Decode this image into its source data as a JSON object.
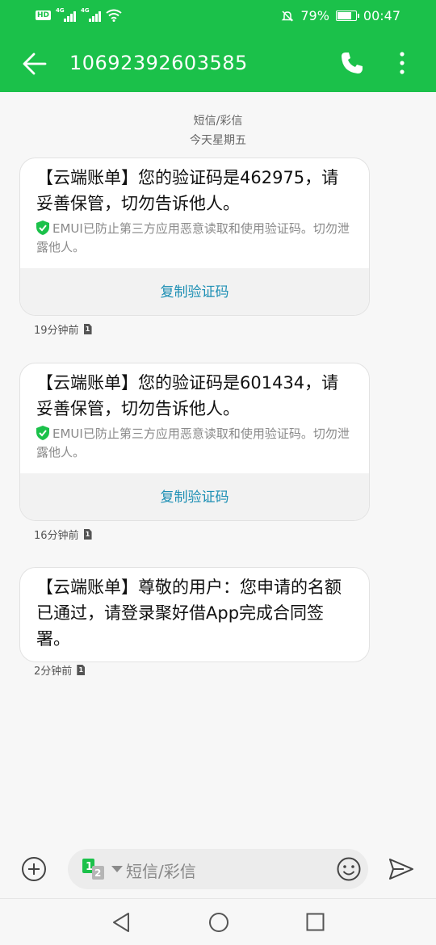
{
  "status": {
    "hd": "HD",
    "net1": "4G",
    "net2": "4G",
    "battery": "79%",
    "battery_level": 0.79,
    "time": "00:47"
  },
  "appbar": {
    "title": "10692392603585"
  },
  "thread": {
    "type_label": "短信/彩信",
    "date_label": "今天星期五"
  },
  "messages": [
    {
      "text": "【云端账单】您的验证码是462975，请妥善保管，切勿告诉他人。",
      "note": "EMUI已防止第三方应用恶意读取和使用验证码。切勿泄露他人。",
      "action": "复制验证码",
      "time": "19分钟前",
      "sim": "1"
    },
    {
      "text": "【云端账单】您的验证码是601434，请妥善保管，切勿告诉他人。",
      "note": "EMUI已防止第三方应用恶意读取和使用验证码。切勿泄露他人。",
      "action": "复制验证码",
      "time": "16分钟前",
      "sim": "1"
    },
    {
      "text": "【云端账单】尊敬的用户：您申请的名额已通过，请登录聚好借App完成合同签署。",
      "time": "2分钟前",
      "sim": "1"
    }
  ],
  "composer": {
    "placeholder": "短信/彩信",
    "sim_main": "1",
    "sim_alt": "2"
  },
  "colors": {
    "brand": "#1bc14a",
    "link": "#1d8fb4"
  }
}
